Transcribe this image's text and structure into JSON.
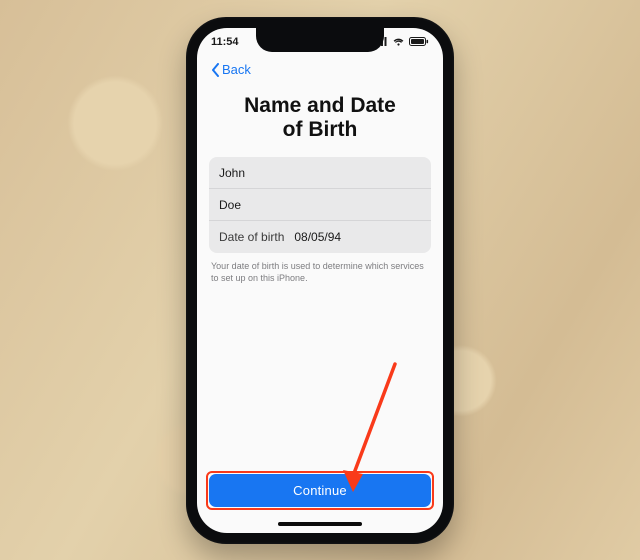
{
  "statusbar": {
    "time": "11:54"
  },
  "nav": {
    "back_label": "Back"
  },
  "screen": {
    "title_line1": "Name and Date",
    "title_line2": "of Birth",
    "first_name": "John",
    "last_name": "Doe",
    "dob_label": "Date of birth",
    "dob_value": "08/05/94",
    "helper_text": "Your date of birth is used to determine which services to set up on this iPhone.",
    "continue_label": "Continue"
  },
  "icons": {
    "chevron_left": "chevron-left-icon",
    "signal": "cellular-signal-icon",
    "wifi": "wifi-icon",
    "battery": "battery-icon"
  },
  "callout": {
    "arrow_color": "#f93a1a"
  }
}
